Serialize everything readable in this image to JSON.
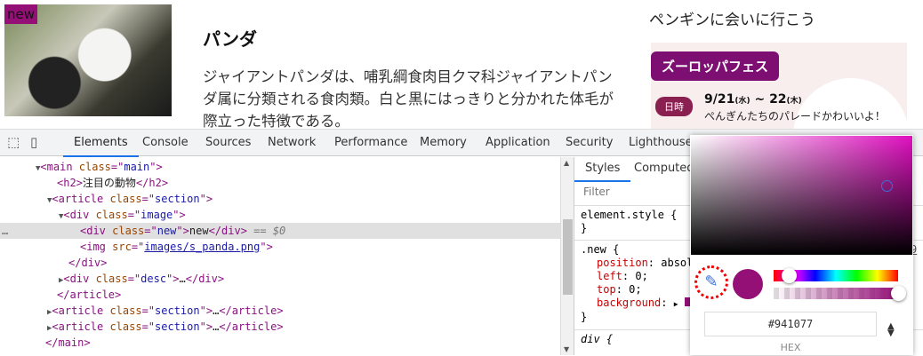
{
  "page": {
    "new_label": "new",
    "title": "パンダ",
    "description": "ジャイアントパンダは、哺乳綱食肉目クマ科ジャイアントパンダ属に分類される食肉類。白と黒にはっきりと分かれた体毛が際立った特徴である。",
    "side_title": "ペンギンに会いに行こう",
    "banner": {
      "fes": "ズーロッパフェス",
      "badge": "日時",
      "date_start": "9/21",
      "dow1": "(水)",
      "sep": " ~ ",
      "date_end": "22",
      "dow2": "(木)",
      "sub": "ぺんぎんたちのパレードかわいいよ！"
    }
  },
  "devtools": {
    "tabs": [
      "Elements",
      "Console",
      "Sources",
      "Network",
      "Performance",
      "Memory",
      "Application",
      "Security",
      "Lighthouse"
    ],
    "active_tab": "Elements",
    "dom": [
      {
        "t": "<main class=\"main\">"
      },
      {
        "t": "<h2>注目の動物</h2>"
      },
      {
        "t": "<article class=\"section\">"
      },
      {
        "t": "<div class=\"image\">"
      },
      {
        "t": "<div class=\"new\">new</div> == $0"
      },
      {
        "t": "<img src=\"images/s_panda.png\">"
      },
      {
        "t": "</div>"
      },
      {
        "t": "<div class=\"desc\">…</div>"
      },
      {
        "t": "</article>"
      },
      {
        "t": "<article class=\"section\">…</article>"
      },
      {
        "t": "<article class=\"section\">…</article>"
      },
      {
        "t": "</main>"
      }
    ],
    "styles": {
      "tabs": [
        "Styles",
        "Computed"
      ],
      "filter_placeholder": "Filter",
      "element_style": "element.style {",
      "close": "}",
      "rule_selector": ".new {",
      "props": [
        [
          "position",
          "absol"
        ],
        [
          "left",
          "0;"
        ],
        [
          "top",
          "0;"
        ],
        [
          "background",
          ""
        ]
      ],
      "div_selector": "div {",
      "line_ref": "9"
    },
    "picker": {
      "color": "#941077",
      "hex_value": "#941077",
      "format_label": "HEX",
      "updown": "▲▼"
    }
  }
}
